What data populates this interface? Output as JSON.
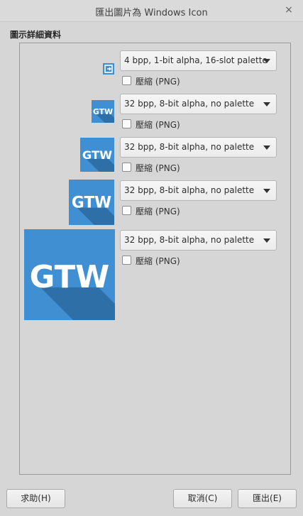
{
  "window": {
    "title": "匯出圖片為 Windows Icon",
    "close_glyph": "×"
  },
  "section_title": "圖示詳細資料",
  "rows": [
    {
      "icon": "small-export-icon",
      "format": "4 bpp, 1-bit alpha, 16-slot palette",
      "compress_label": "壓縮 (PNG)",
      "compress_checked": false
    },
    {
      "icon": "gtw-logo-icon",
      "icon_text": "GTW",
      "format": "32 bpp, 8-bit alpha, no palette",
      "compress_label": "壓縮 (PNG)",
      "compress_checked": false
    },
    {
      "icon": "gtw-logo-icon",
      "icon_text": "GTW",
      "format": "32 bpp, 8-bit alpha, no palette",
      "compress_label": "壓縮 (PNG)",
      "compress_checked": false
    },
    {
      "icon": "gtw-logo-icon",
      "icon_text": "GTW",
      "format": "32 bpp, 8-bit alpha, no palette",
      "compress_label": "壓縮 (PNG)",
      "compress_checked": false
    },
    {
      "icon": "gtw-logo-icon",
      "icon_text": "GTW",
      "format": "32 bpp, 8-bit alpha, no palette",
      "compress_label": "壓縮 (PNG)",
      "compress_checked": false
    }
  ],
  "buttons": {
    "help": "求助(H)",
    "cancel": "取消(C)",
    "export": "匯出(E)"
  },
  "colors": {
    "icon_blue": "#3f8fd2",
    "icon_shadow": "#2f6fa8",
    "icon_text": "#ffffff"
  }
}
